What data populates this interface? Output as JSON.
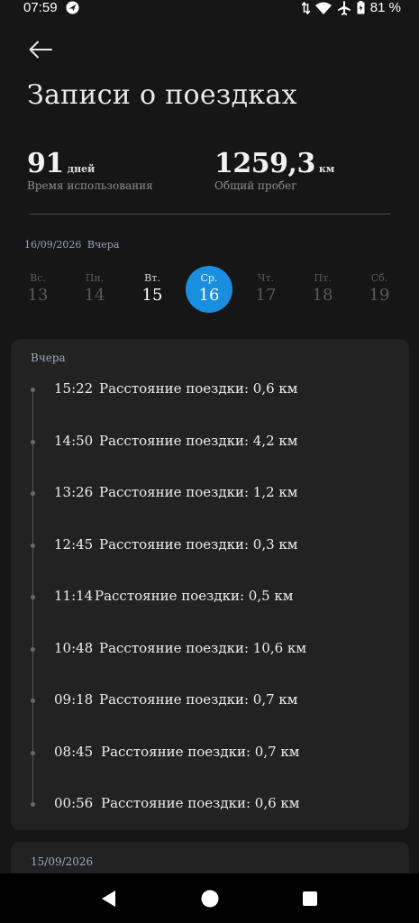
{
  "status": {
    "time": "07:59",
    "battery": "81 %"
  },
  "header": {
    "title": "Записи о поездках"
  },
  "stats": [
    {
      "value": "91",
      "unit": "дней",
      "label": "Время использования"
    },
    {
      "value": "1259,3",
      "unit": "км",
      "label": "Общий пробег"
    }
  ],
  "selected_date": {
    "date": "16/09/2026",
    "relative": "Вчера"
  },
  "week": [
    {
      "name": "Вс.",
      "num": "13",
      "state": "future"
    },
    {
      "name": "Пн.",
      "num": "14",
      "state": "future"
    },
    {
      "name": "Вт.",
      "num": "15",
      "state": "past"
    },
    {
      "name": "Ср.",
      "num": "16",
      "state": "selected"
    },
    {
      "name": "Чт.",
      "num": "17",
      "state": "future"
    },
    {
      "name": "Пт.",
      "num": "18",
      "state": "future"
    },
    {
      "name": "Сб.",
      "num": "19",
      "state": "future"
    }
  ],
  "trip_group": {
    "heading": "Вчера",
    "trips": [
      {
        "time": "15:22",
        "text": "Расстояние поездки: 0,6 км"
      },
      {
        "time": "14:50",
        "text": "Расстояние поездки: 4,2 км"
      },
      {
        "time": "13:26",
        "text": "Расстояние поездки: 1,2 км"
      },
      {
        "time": "12:45",
        "text": "Расстояние поездки: 0,3 км"
      },
      {
        "time": "11:14",
        "text": "Расстояние поездки: 0,5 км"
      },
      {
        "time": "10:48",
        "text": "Расстояние поездки: 10,6 км"
      },
      {
        "time": "09:18",
        "text": "Расстояние поездки: 0,7 км"
      },
      {
        "time": "08:45",
        "text": "Расстояние поездки: 0,7 км"
      },
      {
        "time": "00:56",
        "text": "Расстояние поездки: 0,6 км"
      }
    ]
  },
  "next_group": {
    "heading": "15/09/2026"
  },
  "colors": {
    "accent": "#1a8fe0",
    "background": "#161616",
    "card": "#222222"
  },
  "icons": [
    "navigation-icon",
    "data-icon",
    "wifi-icon",
    "airplane-icon",
    "battery-icon",
    "back-arrow-icon",
    "nav-back-icon",
    "nav-home-icon",
    "nav-recents-icon"
  ]
}
